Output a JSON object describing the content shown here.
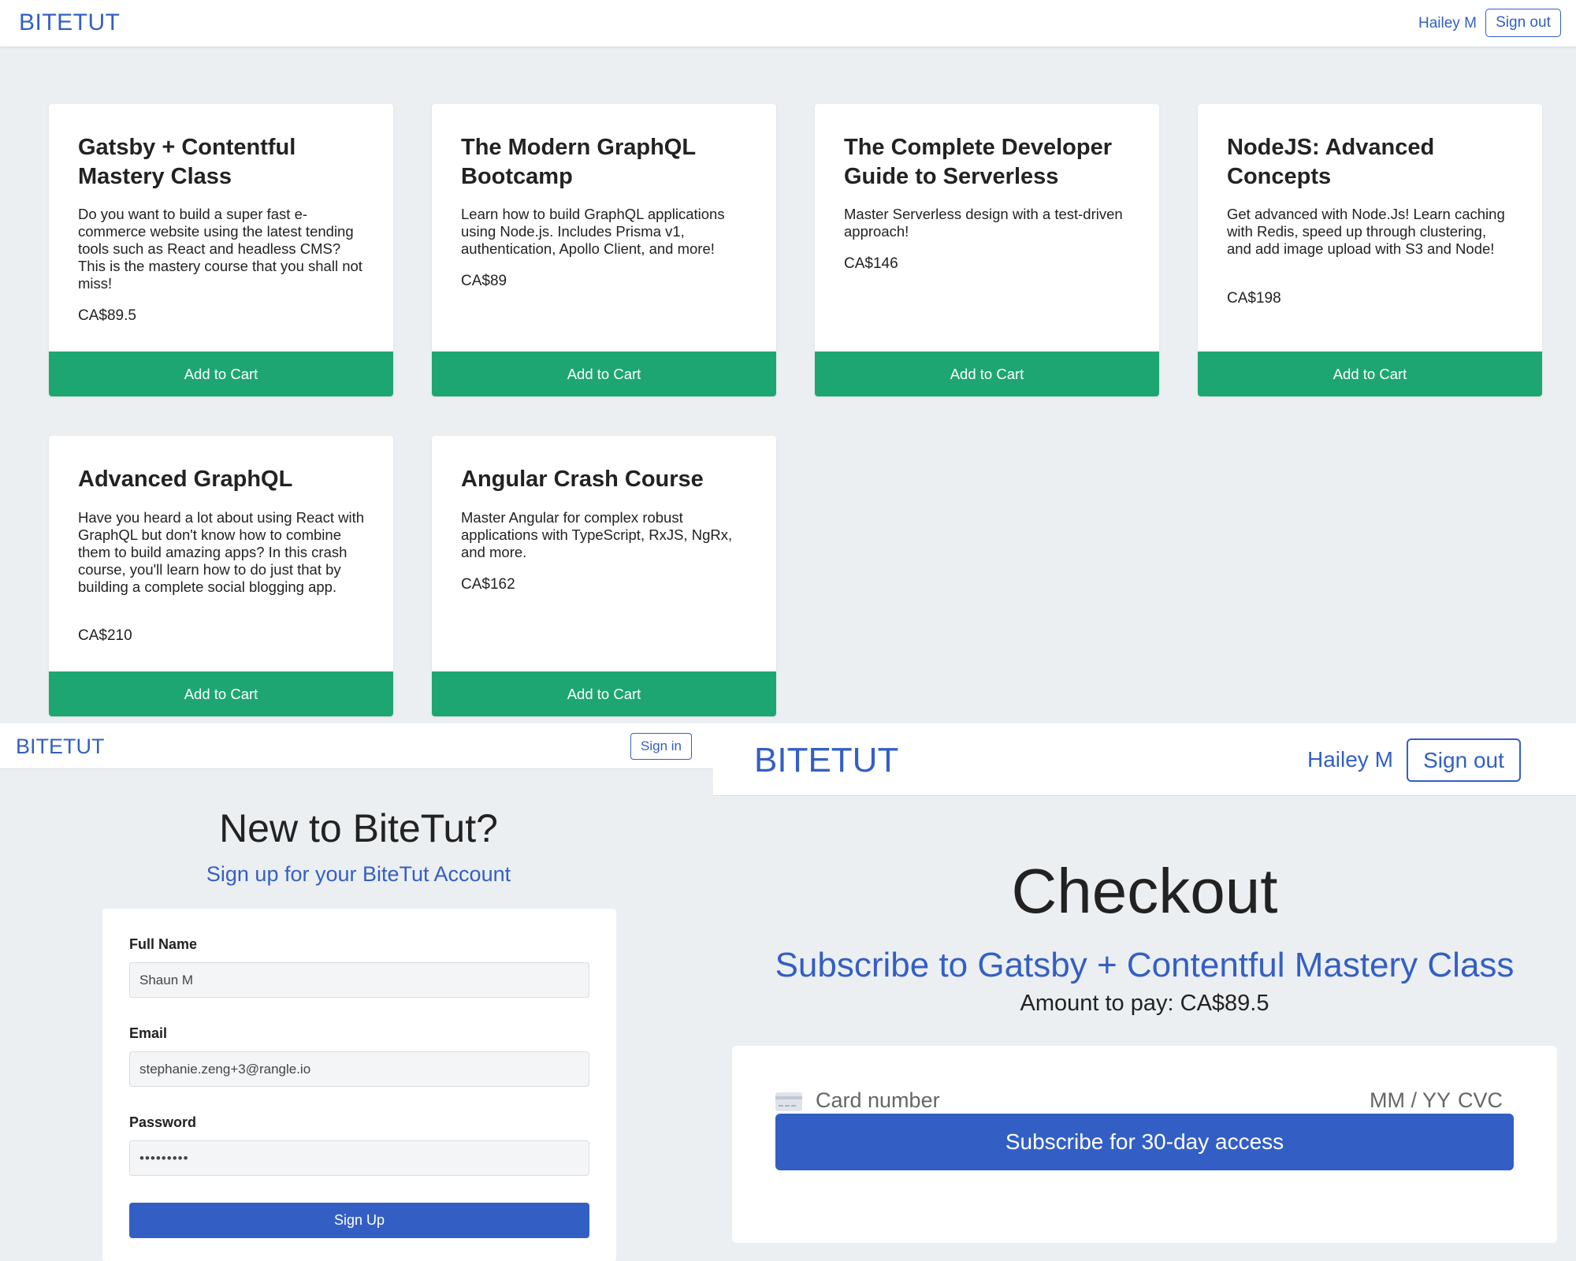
{
  "topbar": {
    "logo": "BITETUT",
    "user": "Hailey M",
    "signout": "Sign out"
  },
  "courses": [
    {
      "title": "Gatsby + Contentful Mastery Class",
      "description": "Do you want to build a super fast e-commerce website using the latest tending tools such as React and headless CMS? This is the mastery course that you shall not miss!",
      "price": "CA$89.5",
      "button": "Add to Cart"
    },
    {
      "title": "The Modern GraphQL Bootcamp",
      "description": "Learn how to build GraphQL applications using Node.js. Includes Prisma v1, authentication, Apollo Client, and more!",
      "price": "CA$89",
      "button": "Add to Cart"
    },
    {
      "title": "The Complete Developer Guide to Serverless",
      "description": "Master Serverless design with a test-driven approach!",
      "price": "CA$146",
      "button": "Add to Cart"
    },
    {
      "title": "NodeJS: Advanced Concepts",
      "description": "Get advanced with Node.Js! Learn caching with Redis, speed up through clustering, and add image upload with S3 and Node!",
      "price": "CA$198",
      "button": "Add to Cart"
    },
    {
      "title": "Advanced GraphQL",
      "description": "Have you heard a lot about using React with GraphQL but don't know how to combine them to build amazing apps? In this crash course, you'll learn how to do just that by building a complete social blogging app.",
      "price": "CA$210",
      "button": "Add to Cart"
    },
    {
      "title": "Angular Crash Course",
      "description": "Master Angular for complex robust applications with TypeScript, RxJS, NgRx, and more.",
      "price": "CA$162",
      "button": "Add to Cart"
    }
  ],
  "signup": {
    "logo": "BITETUT",
    "signin": "Sign in",
    "heading": "New to BiteTut?",
    "subheading": "Sign up for your BiteTut Account",
    "fullname_label": "Full Name",
    "fullname_value": "Shaun M",
    "email_label": "Email",
    "email_value": "stephanie.zeng+3@rangle.io",
    "password_label": "Password",
    "password_value": "•••••••••",
    "button": "Sign Up"
  },
  "checkout": {
    "logo": "BITETUT",
    "user": "Hailey M",
    "signout": "Sign out",
    "title": "Checkout",
    "subtitle": "Subscribe to Gatsby + Contentful Mastery Class",
    "amount_label": "Amount to pay:",
    "amount_value": "CA$89.5",
    "card_placeholder": "Card number",
    "expiry_placeholder": "MM / YY",
    "cvc_placeholder": "CVC",
    "button": "Subscribe for 30-day access",
    "card_icon": "credit-card-icon"
  },
  "colors": {
    "brand_blue": "#335fc5",
    "cart_green": "#1ea672",
    "background": "#eceff1"
  }
}
